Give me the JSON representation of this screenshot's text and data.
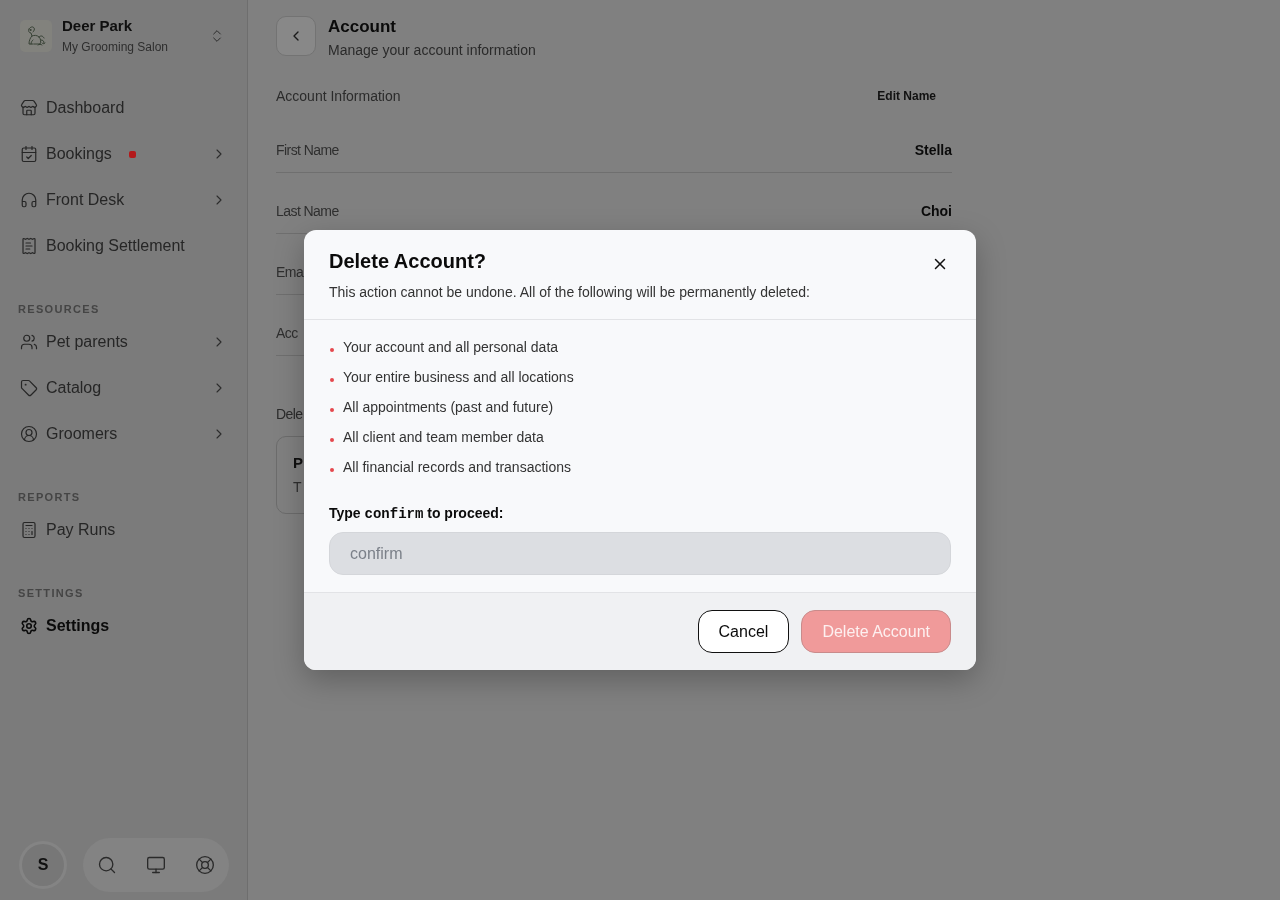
{
  "sidebar": {
    "business": {
      "name": "Deer Park",
      "subtitle": "My Grooming Salon"
    },
    "sections": [
      {
        "items": [
          {
            "label": "Dashboard",
            "selected": false,
            "has_submenu": false,
            "has_alert": false
          },
          {
            "label": "Bookings",
            "selected": false,
            "has_submenu": true,
            "has_alert": true
          },
          {
            "label": "Front Desk",
            "selected": false,
            "has_submenu": true,
            "has_alert": false
          },
          {
            "label": "Booking Settlement",
            "selected": false,
            "has_submenu": false,
            "has_alert": false
          }
        ]
      },
      {
        "heading": "RESOURCES",
        "items": [
          {
            "label": "Pet parents",
            "selected": false,
            "has_submenu": true,
            "has_alert": false
          },
          {
            "label": "Catalog",
            "selected": false,
            "has_submenu": true,
            "has_alert": false
          },
          {
            "label": "Groomers",
            "selected": false,
            "has_submenu": true,
            "has_alert": false
          }
        ]
      },
      {
        "heading": "REPORTS",
        "items": [
          {
            "label": "Pay Runs",
            "selected": false,
            "has_submenu": false,
            "has_alert": false
          }
        ]
      },
      {
        "heading": "SETTINGS",
        "items": [
          {
            "label": "Settings",
            "selected": true,
            "has_submenu": false,
            "has_alert": false
          }
        ]
      }
    ],
    "user": {
      "initial": "S"
    }
  },
  "page": {
    "title": "Account",
    "subtitle": "Manage your account information",
    "section_title": "Account Information",
    "edit_action": "Edit Name",
    "fields": [
      {
        "label": "First Name",
        "value": "Stella"
      },
      {
        "label": "Last Name",
        "value": "Choi"
      },
      {
        "label": "Ema"
      },
      {
        "label": "Acc"
      }
    ],
    "danger_heading": "Dele",
    "danger_card": {
      "title": "P",
      "text": "T"
    }
  },
  "dialog": {
    "title": "Delete Account?",
    "description": "This action cannot be undone. All of the following will be permanently deleted:",
    "items": [
      "Your account and all personal data",
      "Your entire business and all locations",
      "All appointments (past and future)",
      "All client and team member data",
      "All financial records and transactions"
    ],
    "confirm_prompt": {
      "prefix": "Type",
      "keyword": "confirm",
      "suffix": "to proceed:"
    },
    "input": {
      "placeholder": "confirm"
    },
    "buttons": [
      {
        "label": "Cancel",
        "kind": "secondary",
        "disabled": false
      },
      {
        "label": "Delete Account",
        "kind": "destructive",
        "disabled": true
      }
    ]
  }
}
